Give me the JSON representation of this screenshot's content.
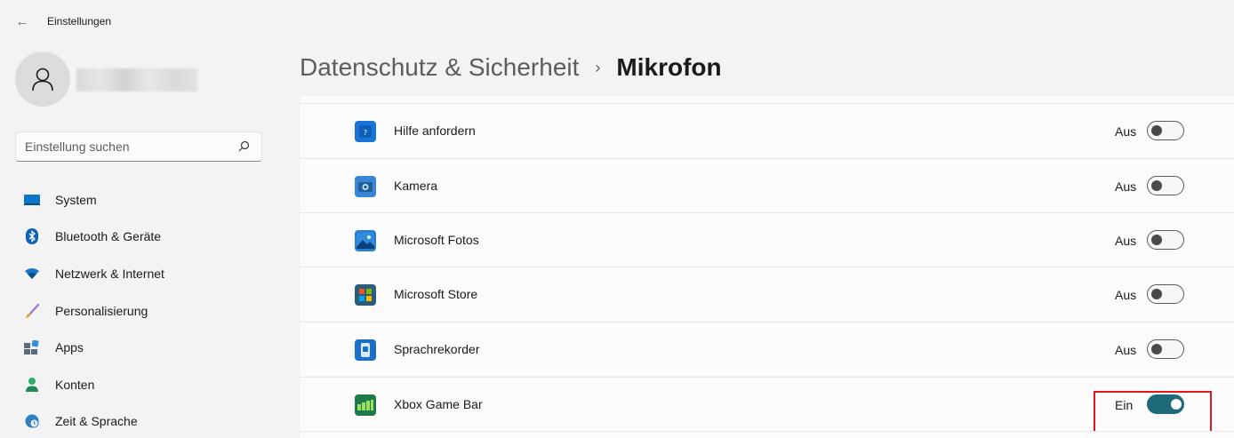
{
  "window": {
    "title": "Einstellungen"
  },
  "sidebar": {
    "search_placeholder": "Einstellung suchen",
    "items": [
      {
        "label": "System",
        "icon": "display-icon"
      },
      {
        "label": "Bluetooth & Geräte",
        "icon": "bluetooth-icon"
      },
      {
        "label": "Netzwerk & Internet",
        "icon": "wifi-icon"
      },
      {
        "label": "Personalisierung",
        "icon": "brush-icon"
      },
      {
        "label": "Apps",
        "icon": "apps-icon"
      },
      {
        "label": "Konten",
        "icon": "person-icon"
      },
      {
        "label": "Zeit & Sprache",
        "icon": "globe-clock-icon"
      }
    ]
  },
  "header": {
    "parent": "Datenschutz & Sicherheit",
    "separator": "›",
    "current": "Mikrofon"
  },
  "apps": [
    {
      "name": "Hilfe anfordern",
      "state": "Aus",
      "on": false,
      "icon": "help-app-icon"
    },
    {
      "name": "Kamera",
      "state": "Aus",
      "on": false,
      "icon": "camera-app-icon"
    },
    {
      "name": "Microsoft Fotos",
      "state": "Aus",
      "on": false,
      "icon": "photos-app-icon"
    },
    {
      "name": "Microsoft Store",
      "state": "Aus",
      "on": false,
      "icon": "store-app-icon"
    },
    {
      "name": "Sprachrekorder",
      "state": "Aus",
      "on": false,
      "icon": "recorder-app-icon"
    },
    {
      "name": "Xbox Game Bar",
      "state": "Ein",
      "on": true,
      "icon": "xbox-game-bar-icon",
      "highlighted": true
    }
  ],
  "colors": {
    "accent": "#1f6a7a",
    "highlight": "#e0161c"
  }
}
